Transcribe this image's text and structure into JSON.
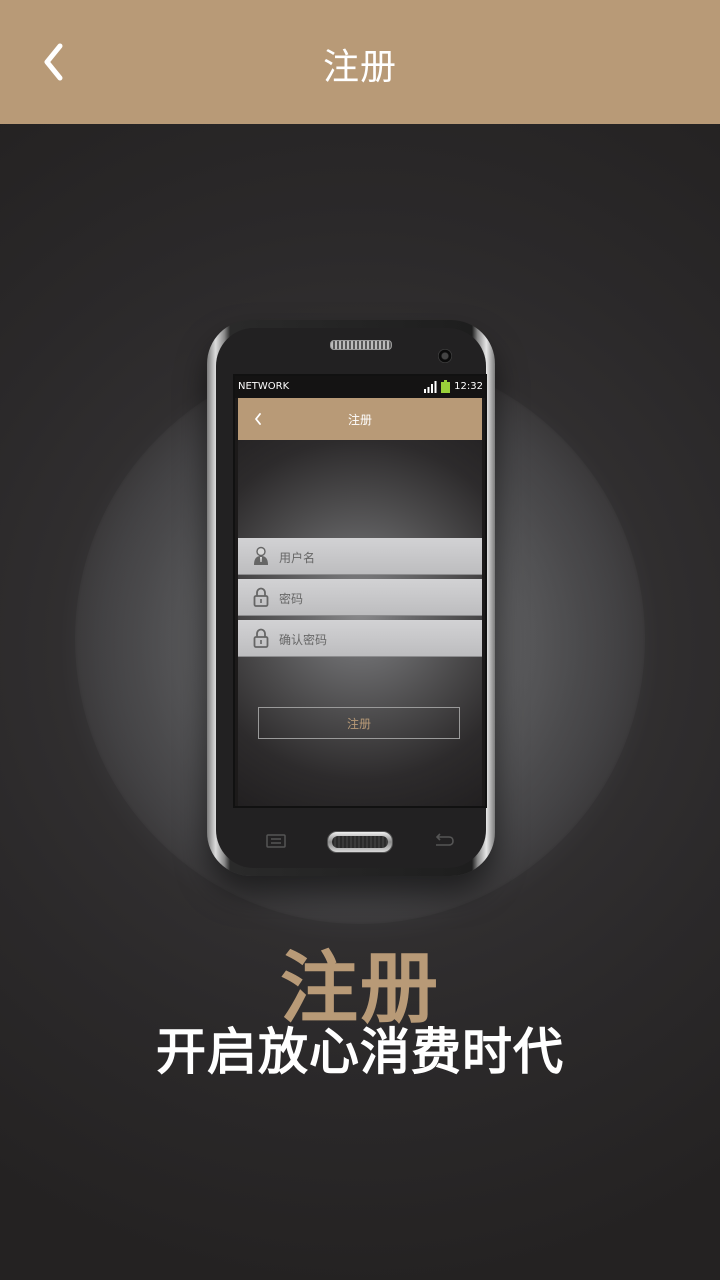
{
  "header": {
    "title": "注册",
    "back_icon": "chevron-left-icon"
  },
  "phone": {
    "status": {
      "network": "NETWORK",
      "time": "12:32"
    },
    "screen_header": {
      "title": "注册"
    },
    "inputs": [
      {
        "placeholder": "用户名",
        "icon": "user-icon"
      },
      {
        "placeholder": "密码",
        "icon": "lock-icon"
      },
      {
        "placeholder": "确认密码",
        "icon": "lock-icon"
      }
    ],
    "button": "注册"
  },
  "hero": {
    "headline": "注册",
    "tagline": "开启放心消费时代"
  },
  "colors": {
    "accent": "#b89a77",
    "background": "#242222"
  }
}
